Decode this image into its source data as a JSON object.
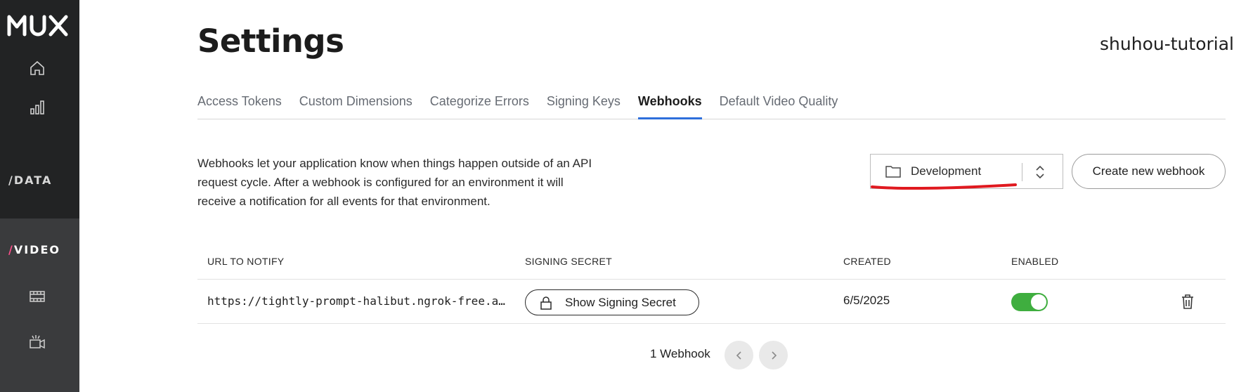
{
  "sidebar": {
    "logo": "MUX",
    "sections": {
      "data_label": "DATA",
      "video_label": "VIDEO",
      "slash": "/"
    },
    "icons": [
      "home-icon",
      "bar-chart-icon",
      "film-icon",
      "video-camera-icon"
    ]
  },
  "header": {
    "title": "Settings",
    "environment": "shuhou-tutorial"
  },
  "tabs": [
    {
      "label": "Access Tokens",
      "active": false
    },
    {
      "label": "Custom Dimensions",
      "active": false
    },
    {
      "label": "Categorize Errors",
      "active": false
    },
    {
      "label": "Signing Keys",
      "active": false
    },
    {
      "label": "Webhooks",
      "active": true
    },
    {
      "label": "Default Video Quality",
      "active": false
    }
  ],
  "webhooks": {
    "description": "Webhooks let your application know when things happen outside of an API request cycle. After a webhook is configured for an environment it will receive a notification for all events for that environment.",
    "environment_select": {
      "value": "Development",
      "icon": "folder-icon"
    },
    "create_button": "Create new webhook",
    "table": {
      "columns": [
        "URL TO NOTIFY",
        "SIGNING SECRET",
        "CREATED",
        "ENABLED"
      ],
      "rows": [
        {
          "url": "https://tightly-prompt-halibut.ngrok-free.app/webhooks",
          "secret_button": "Show Signing Secret",
          "created": "6/5/2025",
          "enabled": true
        }
      ]
    },
    "pagination": {
      "count": "1 Webhook"
    }
  },
  "colors": {
    "sidebar": "#222324",
    "sidebar_active": "#3a3b3d",
    "accent_tab": "#2e6fdb",
    "toggle_on": "#3fae3f",
    "annotation": "#e0191f",
    "video_slash": "#ff4f8b"
  }
}
